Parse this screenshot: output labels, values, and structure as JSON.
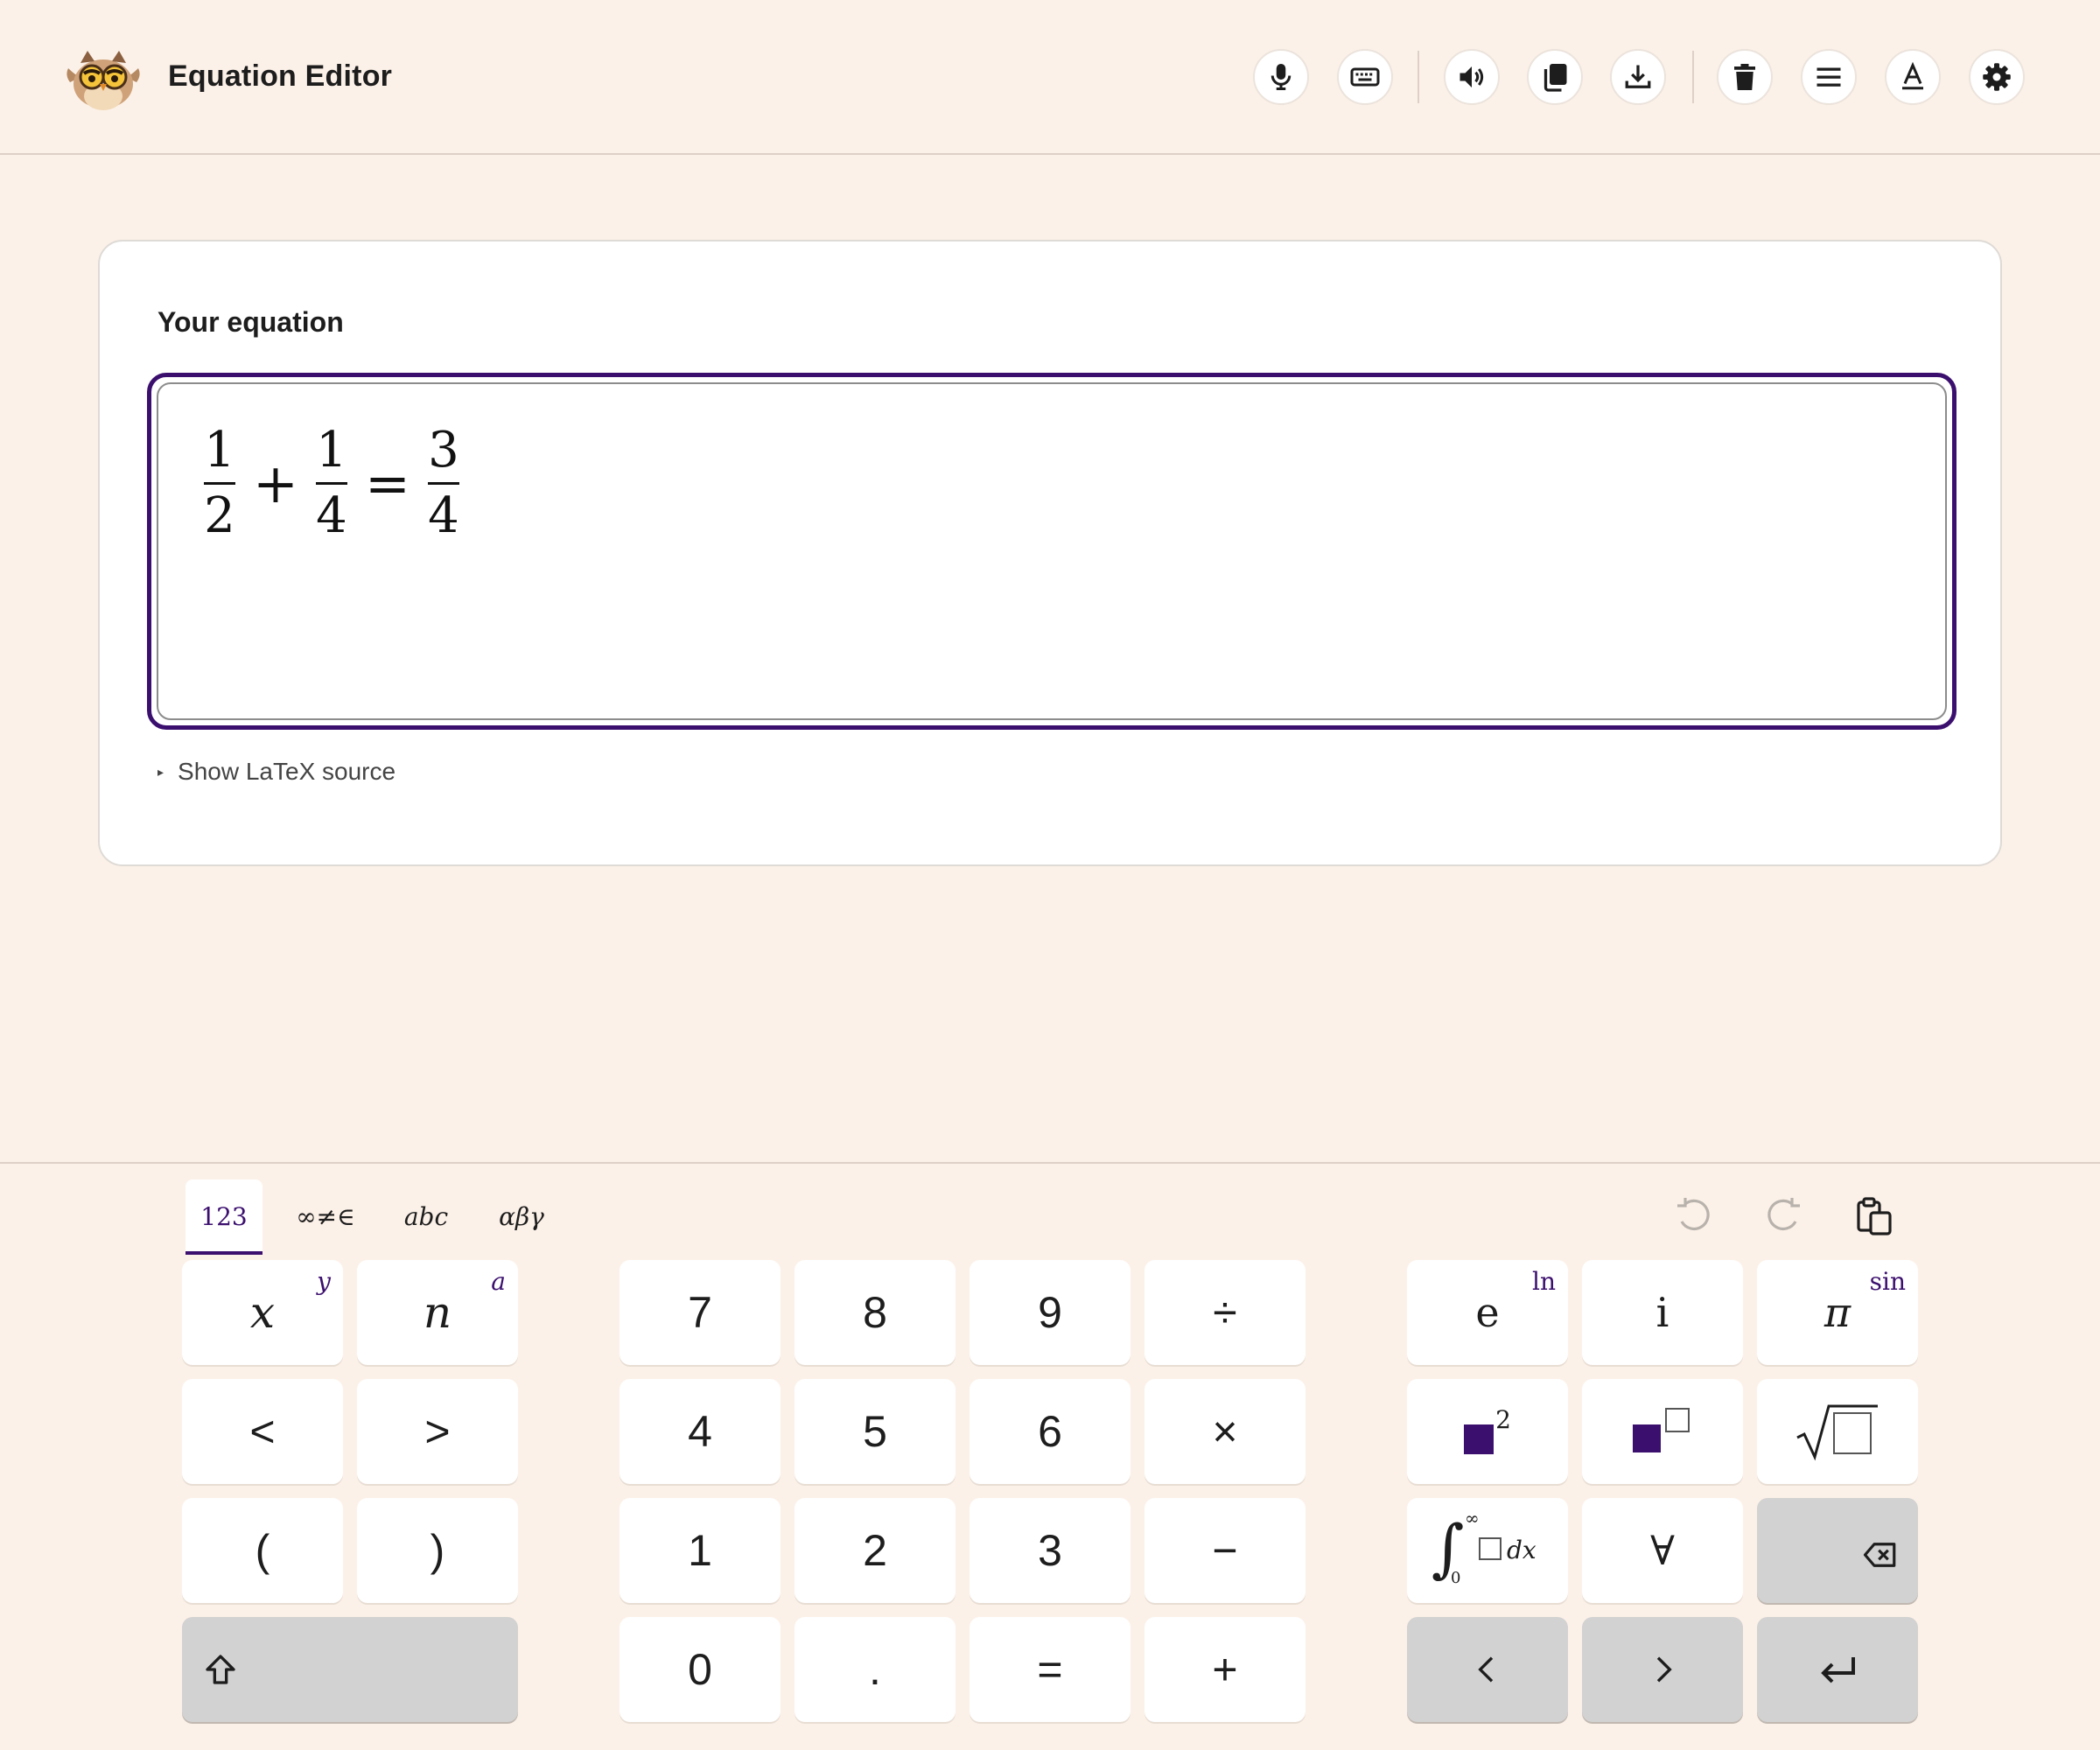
{
  "app": {
    "title": "Equation Editor"
  },
  "toolbar": {
    "buttons": [
      {
        "name": "microphone",
        "icon": "microphone-icon"
      },
      {
        "name": "keyboard",
        "icon": "keyboard-icon"
      },
      {
        "name": "speaker",
        "icon": "speaker-icon"
      },
      {
        "name": "copy",
        "icon": "copy-icon"
      },
      {
        "name": "download",
        "icon": "download-icon"
      },
      {
        "name": "delete",
        "icon": "trash-icon"
      },
      {
        "name": "menu",
        "icon": "menu-icon"
      },
      {
        "name": "font",
        "icon": "font-icon"
      },
      {
        "name": "settings",
        "icon": "gear-icon"
      }
    ]
  },
  "editor": {
    "label": "Your equation",
    "equation": {
      "frac1": {
        "num": "1",
        "den": "2"
      },
      "op1": "+",
      "frac2": {
        "num": "1",
        "den": "4"
      },
      "op2": "=",
      "frac3": {
        "num": "3",
        "den": "4"
      }
    },
    "latex_toggle": "Show LaTeX source"
  },
  "keyboard": {
    "tabs": [
      {
        "label": "123",
        "active": true
      },
      {
        "label": "∞≠∈",
        "active": false
      },
      {
        "label": "abc",
        "active": false
      },
      {
        "label": "αβγ",
        "active": false
      }
    ],
    "actions": [
      "undo-icon",
      "redo-icon",
      "paste-icon"
    ],
    "left": {
      "x": {
        "label": "x",
        "shift": "y"
      },
      "n": {
        "label": "n",
        "shift": "a"
      },
      "lt": "<",
      "gt": ">",
      "lparen": "(",
      "rparen": ")"
    },
    "numpad": {
      "k7": "7",
      "k8": "8",
      "k9": "9",
      "div": "÷",
      "k4": "4",
      "k5": "5",
      "k6": "6",
      "mul": "×",
      "k1": "1",
      "k2": "2",
      "k3": "3",
      "minus": "−",
      "k0": "0",
      "dot": ".",
      "eq": "=",
      "plus": "+"
    },
    "right": {
      "e": {
        "label": "e",
        "shift": "ln"
      },
      "i": {
        "label": "i"
      },
      "pi": {
        "label": "π",
        "shift": "sin"
      },
      "square_exp": "2",
      "integral": {
        "upper": "∞",
        "lower": "0",
        "dx": "dx"
      },
      "forall": "∀"
    },
    "colors": {
      "accent": "#3b0f6e",
      "key": "#ffffff",
      "key_gray": "#d2d2d2",
      "background": "#fcf1e8"
    }
  }
}
